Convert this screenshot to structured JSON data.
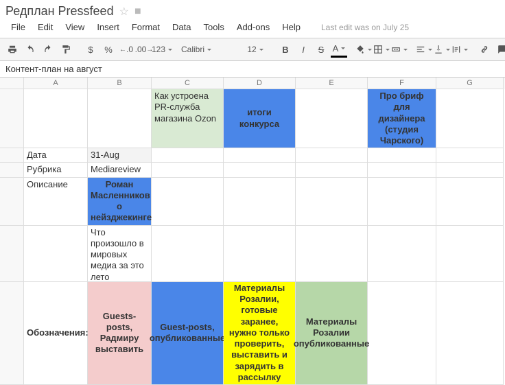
{
  "doc": {
    "title": "Редплан Pressfeed",
    "last_edit": "Last edit was on July 25"
  },
  "menus": [
    "File",
    "Edit",
    "View",
    "Insert",
    "Format",
    "Data",
    "Tools",
    "Add-ons",
    "Help"
  ],
  "toolbar": {
    "currency": "$",
    "percent": "%",
    "dec_less": ".0",
    "dec_more": ".00",
    "numfmt": "123",
    "font": "Calibri",
    "size": "12",
    "bold": "B",
    "italic": "I",
    "strike": "S",
    "textcolor": "A"
  },
  "formula": "Контент-план на август",
  "cols": [
    "A",
    "B",
    "C",
    "D",
    "E",
    "F",
    "G"
  ],
  "cells": {
    "r1": {
      "C": "Как устроена PR-служба магазина Ozon",
      "D": "итоги конкурса",
      "F": "Про бриф для дизайнера (студия Чарского)"
    },
    "r2": {
      "A": "Дата",
      "B": "31-Aug"
    },
    "r3": {
      "A": "Рубрика",
      "B": "Mediareview"
    },
    "r4": {
      "A": "Описание",
      "B": "Роман Масленников о нейзджекинге"
    },
    "r5": {
      "B": "Что произошло в мировых медиа за это лето"
    },
    "r6": {
      "A": "Обозначения:",
      "B": "Guests-posts, Радмиру выставить",
      "C": "Guest-posts, опубликованные",
      "D": "Материалы Розалии, готовые заранее, нужно только проверить, выставить и зарядить в рассылку",
      "E": "Материалы Розалии опубликованные"
    }
  }
}
